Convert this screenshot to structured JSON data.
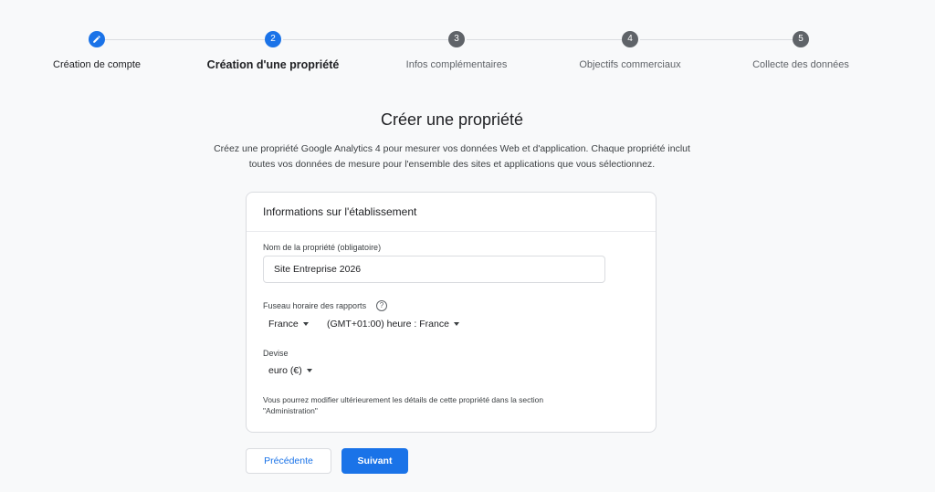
{
  "stepper": {
    "steps": [
      {
        "number": "",
        "label": "Création de compte",
        "state": "done",
        "icon": "pencil-icon"
      },
      {
        "number": "2",
        "label": "Création d'une propriété",
        "state": "active"
      },
      {
        "number": "3",
        "label": "Infos complémentaires",
        "state": "pending"
      },
      {
        "number": "4",
        "label": "Objectifs commerciaux",
        "state": "pending"
      },
      {
        "number": "5",
        "label": "Collecte des données",
        "state": "pending"
      }
    ]
  },
  "page": {
    "title": "Créer une propriété",
    "description_line1": "Créez une propriété Google Analytics 4 pour mesurer vos données Web et d'application. Chaque propriété inclut",
    "description_line2": "toutes vos données de mesure pour l'ensemble des sites et applications que vous sélectionnez."
  },
  "card": {
    "header": "Informations sur l'établissement",
    "property_name": {
      "label": "Nom de la propriété (obligatoire)",
      "value": "Site Entreprise 2026"
    },
    "timezone": {
      "label": "Fuseau horaire des rapports",
      "help_icon": "question-circle-icon",
      "help_glyph": "?",
      "country": "France",
      "zone": "(GMT+01:00) heure : France"
    },
    "currency": {
      "label": "Devise",
      "value": "euro (€)"
    },
    "note_line1": "Vous pourrez modifier ultérieurement les détails de cette propriété dans la section",
    "note_line2": "\"Administration\""
  },
  "buttons": {
    "previous": "Précédente",
    "next": "Suivant"
  },
  "colors": {
    "accent": "#1a73e8",
    "pending_step": "#5f6368",
    "background": "#f8f9fa"
  }
}
